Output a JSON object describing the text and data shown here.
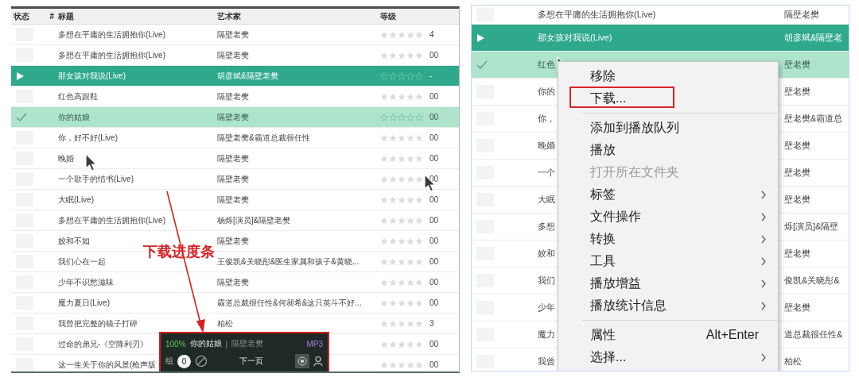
{
  "left_panel": {
    "columns": [
      {
        "label": "状态"
      },
      {
        "label": "#"
      },
      {
        "label": "标题"
      },
      {
        "label": "艺术家"
      },
      {
        "label": "等级"
      }
    ],
    "rows": [
      {
        "playing": false,
        "selected": false,
        "title": "多想在平庸的生活拥抱你(Live)",
        "artist": "隔壁老樊",
        "stars": 0,
        "column_6": "4"
      },
      {
        "playing": false,
        "selected": false,
        "title": "多想在平庸的生活拥抱你(Live)",
        "artist": "隔壁老樊",
        "stars": 0,
        "column_6": "00"
      },
      {
        "playing": true,
        "selected": false,
        "title": "那女孩对我说(Live)",
        "artist": "胡彦斌&隔壁老樊",
        "stars": 0,
        "column_6": "-"
      },
      {
        "playing": false,
        "selected": false,
        "title": "红色高跟鞋",
        "artist": "隔壁老樊",
        "stars": 0,
        "column_6": "00"
      },
      {
        "playing": false,
        "selected": true,
        "title": "你的姑娘",
        "artist": "隔壁老樊",
        "stars": 0,
        "column_6": "00"
      },
      {
        "playing": false,
        "selected": false,
        "title": "你，好不好(Live)",
        "artist": "隔壁老樊&霸道总裁很任性",
        "stars": 0,
        "column_6": "00"
      },
      {
        "playing": false,
        "selected": false,
        "title": "晚婚",
        "artist": "隔壁老樊",
        "stars": 0,
        "column_6": "00"
      },
      {
        "playing": false,
        "selected": false,
        "title": "一个歌手的情书(Live)",
        "artist": "隔壁老樊",
        "stars": 0,
        "column_6": "00"
      },
      {
        "playing": false,
        "selected": false,
        "title": "大眠(Live)",
        "artist": "隔壁老樊",
        "stars": 0,
        "column_6": "00"
      },
      {
        "playing": false,
        "selected": false,
        "title": "多想在平庸的生活拥抱你(Live)",
        "artist": "杨烁[演员]&隔壁老樊",
        "stars": 0,
        "column_6": "00"
      },
      {
        "playing": false,
        "selected": false,
        "title": "姣和不如",
        "artist": "隔壁老樊",
        "stars": 0,
        "column_6": "00"
      },
      {
        "playing": false,
        "selected": false,
        "title": "我们心在一起",
        "artist": "王俊凯&关晓彤&医生家属和孩子&黄晓...",
        "stars": 0,
        "column_6": "00"
      },
      {
        "playing": false,
        "selected": false,
        "title": "少年不识愁滋味",
        "artist": "隔壁老樊",
        "stars": 0,
        "column_6": "00"
      },
      {
        "playing": false,
        "selected": false,
        "title": "魔力夏日(Live)",
        "artist": "霸道总裁很任性&何昶希&这只英斗不好...",
        "stars": 0,
        "column_6": "00"
      },
      {
        "playing": false,
        "selected": false,
        "title": "我曾把完整的镜子打碎",
        "artist": "柏松",
        "stars": 0,
        "column_6": "3"
      },
      {
        "playing": false,
        "selected": false,
        "title": "过命的弟兄-《空降利刃》",
        "stars": 0,
        "column_6": "00"
      },
      {
        "playing": false,
        "selected": false,
        "title": "这一生关于你的风景(枪声版",
        "stars": 0,
        "column_6": "00"
      }
    ],
    "annotation": {
      "label": "下载进度条"
    },
    "download_bar": {
      "percent": "100%",
      "title": "你的姑娘",
      "separator": "|",
      "artist": "隔壁老樊",
      "format": "MP3",
      "group_label": "组",
      "count": "0",
      "next_page": "下一页"
    }
  },
  "right_panel": {
    "rows": [
      {
        "playing": false,
        "selected": false,
        "title": "多想在平庸的生活拥抱你(Live)",
        "artist": "隔壁老樊"
      },
      {
        "playing": true,
        "selected": false,
        "title": "那女孩对我说(Live)",
        "artist": "胡彦斌&隔壁老"
      },
      {
        "playing": false,
        "selected": true,
        "title": "红色",
        "artist": "壁老樊"
      },
      {
        "playing": false,
        "selected": false,
        "title": "你的",
        "artist": "壁老樊"
      },
      {
        "playing": false,
        "selected": false,
        "title": "你，",
        "artist": "壁老樊&霸道总"
      },
      {
        "playing": false,
        "selected": false,
        "title": "晚婚",
        "artist": "壁老樊"
      },
      {
        "playing": false,
        "selected": false,
        "title": "一个",
        "artist": "壁老樊"
      },
      {
        "playing": false,
        "selected": false,
        "title": "大眠",
        "artist": "壁老樊"
      },
      {
        "playing": false,
        "selected": false,
        "title": "多想",
        "artist": "烁[演员]&隔壁"
      },
      {
        "playing": false,
        "selected": false,
        "title": "姣和",
        "artist": "壁老樊"
      },
      {
        "playing": false,
        "selected": false,
        "title": "我们",
        "artist": "俊凯&关晓彤&"
      },
      {
        "playing": false,
        "selected": false,
        "title": "少年",
        "artist": "壁老樊"
      },
      {
        "playing": false,
        "selected": false,
        "title": "魔力",
        "artist": "道总裁很任性&"
      },
      {
        "playing": false,
        "selected": false,
        "title": "我曾",
        "artist": "柏松"
      }
    ],
    "context_menu": {
      "items": [
        {
          "kind": "item",
          "label": "移除",
          "disabled": false,
          "submenu": false,
          "annotated": false
        },
        {
          "kind": "item",
          "label": "下载...",
          "disabled": false,
          "submenu": false,
          "annotated": true
        },
        {
          "kind": "separator"
        },
        {
          "kind": "item",
          "label": "添加到播放队列",
          "disabled": false,
          "submenu": false,
          "annotated": false
        },
        {
          "kind": "item",
          "label": "播放",
          "disabled": false,
          "submenu": false,
          "annotated": false
        },
        {
          "kind": "item",
          "label": "打开所在文件夹",
          "disabled": true,
          "submenu": false,
          "annotated": false
        },
        {
          "kind": "item",
          "label": "标签",
          "disabled": false,
          "submenu": true,
          "annotated": false
        },
        {
          "kind": "item",
          "label": "文件操作",
          "disabled": false,
          "submenu": true,
          "annotated": false
        },
        {
          "kind": "item",
          "label": "转换",
          "disabled": false,
          "submenu": true,
          "annotated": false
        },
        {
          "kind": "item",
          "label": "工具",
          "disabled": false,
          "submenu": true,
          "annotated": false
        },
        {
          "kind": "item",
          "label": "播放增益",
          "disabled": false,
          "submenu": true,
          "annotated": false
        },
        {
          "kind": "item",
          "label": "播放统计信息",
          "disabled": false,
          "submenu": true,
          "annotated": false
        },
        {
          "kind": "separator"
        },
        {
          "kind": "item",
          "label": "属性",
          "shortcut": "Alt+Enter",
          "disabled": false,
          "submenu": false,
          "annotated": false
        },
        {
          "kind": "item",
          "label": "选择...",
          "disabled": false,
          "submenu": true,
          "annotated": false
        }
      ]
    }
  }
}
